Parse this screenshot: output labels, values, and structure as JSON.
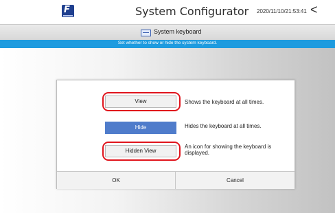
{
  "header": {
    "title": "System Configurator",
    "datetime": "2020/11/10/21:53:41",
    "back_icon": "<",
    "logo_icon": "company-logo"
  },
  "subheader": {
    "icon": "keyboard-icon",
    "title": "System keyboard"
  },
  "info_bar": {
    "text": "Set whether to show or hide the system keyboard."
  },
  "dialog": {
    "options": [
      {
        "label": "View",
        "description": "Shows the keyboard at all times.",
        "selected": false,
        "highlighted": true
      },
      {
        "label": "Hide",
        "description": "Hides the keyboard at all times.",
        "selected": true,
        "highlighted": false
      },
      {
        "label": "Hidden View",
        "description": "An icon for showing the keyboard is displayed.",
        "selected": false,
        "highlighted": true
      }
    ],
    "ok_label": "OK",
    "cancel_label": "Cancel"
  },
  "colors": {
    "info_bar": "#1e9bdf",
    "selected_button": "#4f7ccb",
    "highlight_ring": "#e0141c"
  }
}
